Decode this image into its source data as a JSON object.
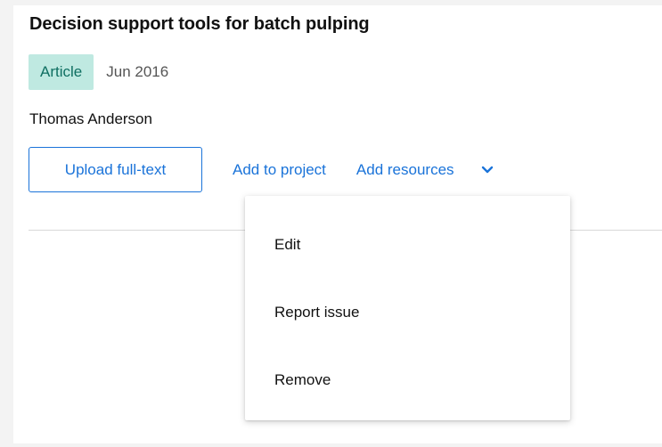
{
  "publication": {
    "title": "Decision support tools for batch pulping",
    "type_badge": "Article",
    "date": "Jun 2016",
    "author": "Thomas Anderson"
  },
  "actions": {
    "upload_label": "Upload full-text",
    "add_project_label": "Add to project",
    "add_resources_label": "Add resources",
    "more_icon": "chevron-down-icon"
  },
  "menu": {
    "items": [
      {
        "label": "Edit"
      },
      {
        "label": "Report issue"
      },
      {
        "label": "Remove"
      }
    ]
  },
  "colors": {
    "accent": "#1a73d9",
    "badge_bg": "#bfe9e1",
    "badge_text": "#0f6f62",
    "background": "#f3f3f3"
  }
}
